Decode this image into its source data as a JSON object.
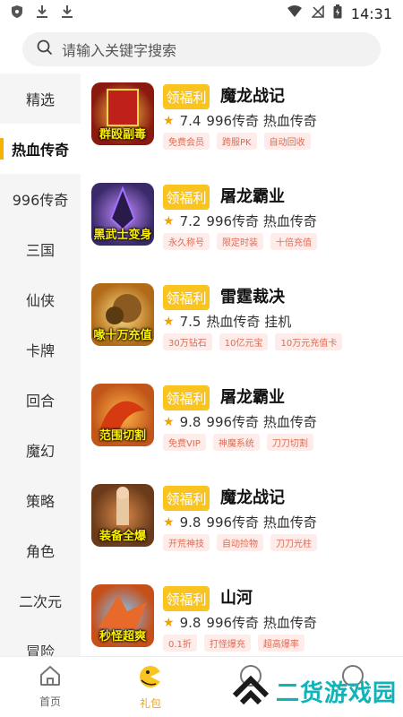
{
  "status_bar": {
    "time": "14:31"
  },
  "search": {
    "placeholder": "请输入关键字搜索"
  },
  "sidebar": {
    "items": [
      {
        "label": "精选"
      },
      {
        "label": "热血传奇",
        "active": true
      },
      {
        "label": "996传奇"
      },
      {
        "label": "三国"
      },
      {
        "label": "仙侠"
      },
      {
        "label": "卡牌"
      },
      {
        "label": "回合"
      },
      {
        "label": "魔幻"
      },
      {
        "label": "策略"
      },
      {
        "label": "角色"
      },
      {
        "label": "二次元"
      },
      {
        "label": "冒险"
      }
    ]
  },
  "games": [
    {
      "badge": "领福利",
      "title": "魔龙战记",
      "rating": "7.4",
      "genre": "996传奇 热血传奇",
      "thumb_caption": "群殴副毒",
      "thumb_color": "#8a1a10",
      "tags": [
        "免费会员",
        "跨服PK",
        "自动回收"
      ]
    },
    {
      "badge": "领福利",
      "title": "屠龙霸业",
      "rating": "7.2",
      "genre": "996传奇 热血传奇",
      "thumb_caption": "黑武士变身",
      "thumb_color": "#3a2a6a",
      "tags": [
        "永久称号",
        "限定时装",
        "十倍充值"
      ]
    },
    {
      "badge": "领福利",
      "title": "雷霆裁决",
      "rating": "7.5",
      "genre": "热血传奇 挂机",
      "thumb_caption": "喙十万充值",
      "thumb_color": "#b06a18",
      "tags": [
        "30万钻石",
        "10亿元宝",
        "10万元充值卡"
      ]
    },
    {
      "badge": "领福利",
      "title": "屠龙霸业",
      "rating": "9.8",
      "genre": "996传奇 热血传奇",
      "thumb_caption": "范围切割",
      "thumb_color": "#c0561a",
      "tags": [
        "免费VIP",
        "神魔系统",
        "刀刀切割"
      ]
    },
    {
      "badge": "领福利",
      "title": "魔龙战记",
      "rating": "9.8",
      "genre": "996传奇 热血传奇",
      "thumb_caption": "装备全爆",
      "thumb_color": "#6a3a1a",
      "tags": [
        "开荒神技",
        "自动捡物",
        "刀刀光柱"
      ]
    },
    {
      "badge": "领福利",
      "title": "山河",
      "rating": "9.8",
      "genre": "996传奇 热血传奇",
      "thumb_caption": "秒怪超爽",
      "thumb_color": "#c6501a",
      "tags": [
        "0.1折",
        "打怪爆充",
        "超高爆率"
      ]
    }
  ],
  "bottom_nav": {
    "items": [
      {
        "label": "首页"
      },
      {
        "label": "礼包",
        "active": true
      }
    ]
  },
  "watermark": {
    "text": "二货游戏园"
  },
  "colors": {
    "accent": "#f9c41f",
    "tag_text": "#e06b52",
    "tag_bg": "#fdecea",
    "watermark": "#0fb3b8"
  }
}
